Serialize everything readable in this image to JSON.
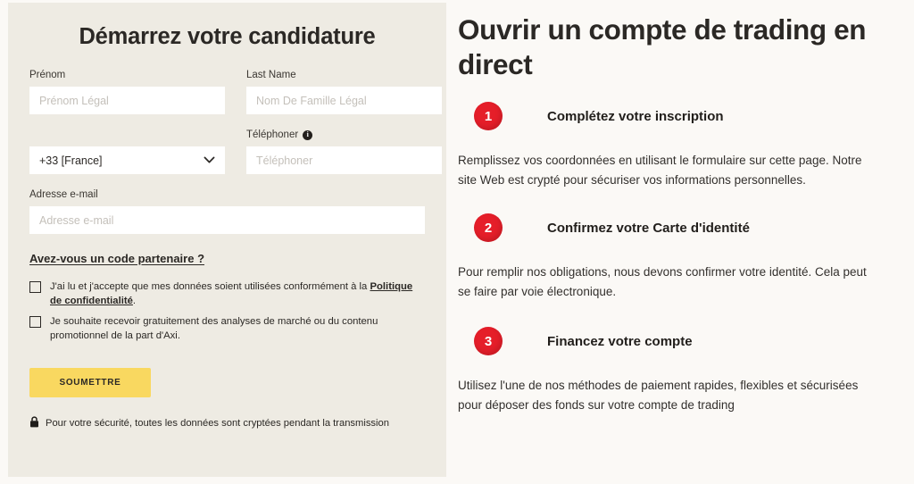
{
  "form": {
    "title": "Démarrez votre candidature",
    "fields": {
      "first_name": {
        "label": "Prénom",
        "placeholder": "Prénom Légal",
        "value": ""
      },
      "last_name": {
        "label": "Last Name",
        "placeholder": "Nom De Famille Légal",
        "value": ""
      },
      "country_code": {
        "label": "",
        "selected": "+33 [France]"
      },
      "phone": {
        "label": "Téléphoner",
        "placeholder": "Téléphoner",
        "value": "",
        "info_icon": "info-icon",
        "info_glyph": "i"
      },
      "email": {
        "label": "Adresse e-mail",
        "placeholder": "Adresse e-mail",
        "value": ""
      }
    },
    "partner_code_link": "Avez-vous un code partenaire ?",
    "consent": {
      "privacy_text_before": "J'ai lu et j'accepte que mes données soient utilisées conformément à la ",
      "privacy_link": "Politique de confidentialité",
      "privacy_text_after": ".",
      "marketing_text": "Je souhaite recevoir gratuitement des analyses de marché ou du contenu promotionnel de la part d'Axi."
    },
    "submit_label": "SOUMETTRE",
    "security_note": "Pour votre sécurité, toutes les données sont cryptées pendant la transmission",
    "lock_icon": "lock-icon",
    "chevron_icon": "chevron-down-icon"
  },
  "info": {
    "heading": "Ouvrir un compte de trading en direct",
    "steps": [
      {
        "number": "1",
        "title": "Complétez votre inscription",
        "body": "Remplissez vos coordonnées en utilisant le formulaire sur cette page. Notre site Web est crypté pour sécuriser vos informations personnelles."
      },
      {
        "number": "2",
        "title": "Confirmez votre Carte d'identité",
        "body": "Pour remplir nos obligations, nous devons confirmer votre identité. Cela peut se faire par voie électronique."
      },
      {
        "number": "3",
        "title": "Financez votre compte",
        "body": "Utilisez l'une de nos méthodes de paiement rapides, flexibles et sécurisées pour déposer des fonds sur votre compte de trading"
      }
    ]
  },
  "colors": {
    "card_bg": "#EEEBE3",
    "page_bg": "#FBF9F6",
    "accent_red": "#E51E29",
    "submit_yellow": "#F9D860",
    "text_dark": "#2B2825"
  }
}
